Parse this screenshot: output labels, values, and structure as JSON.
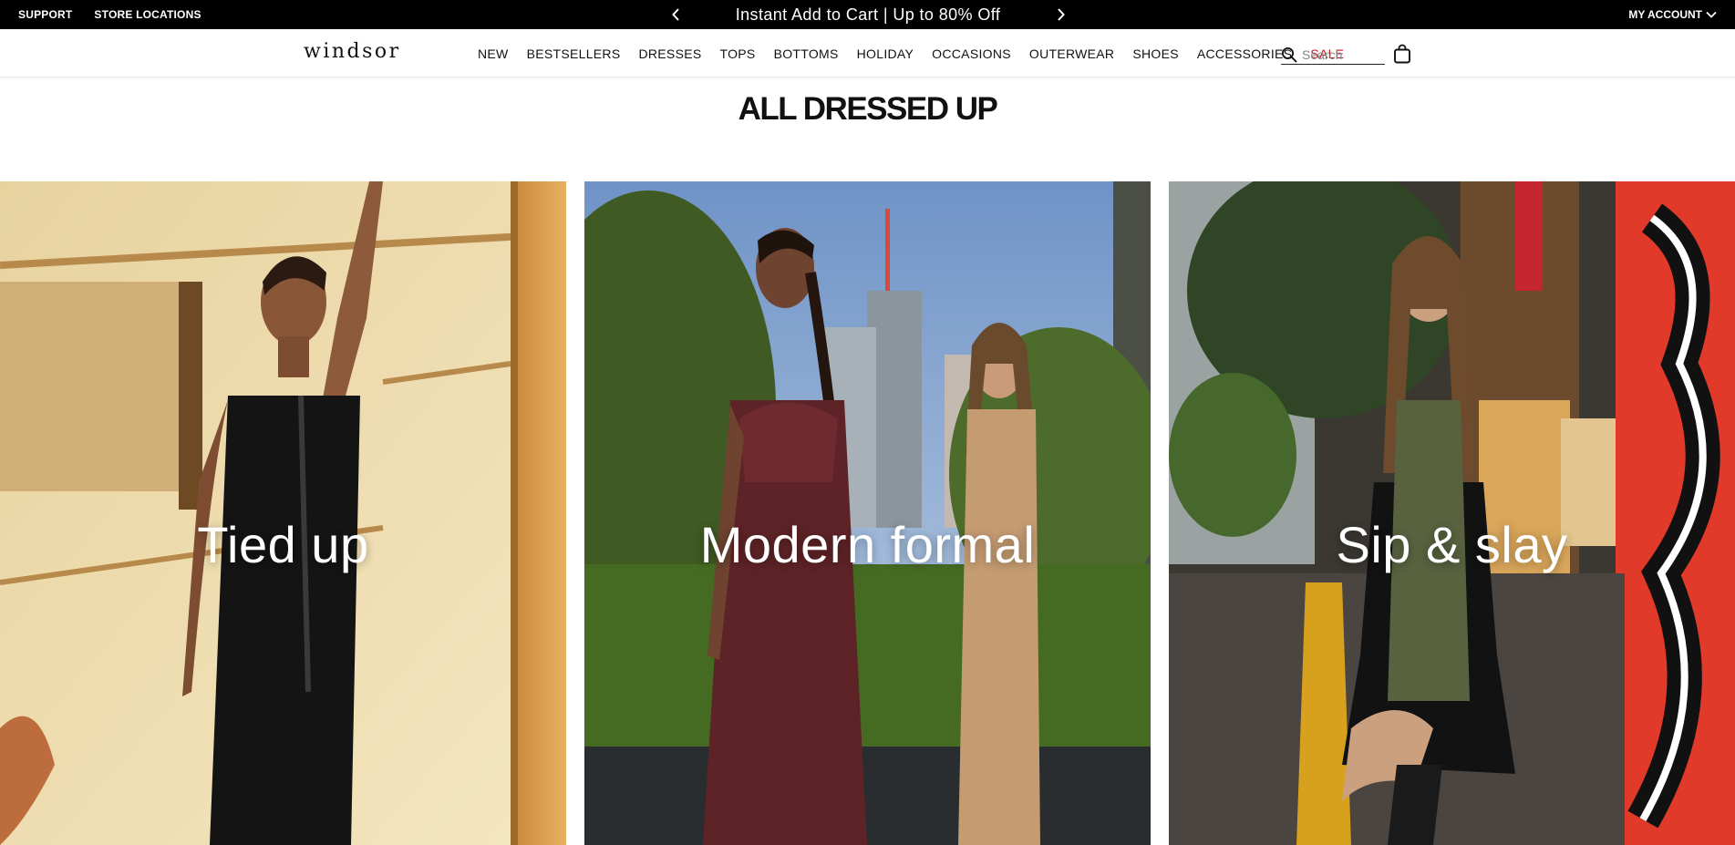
{
  "promo_bar": {
    "left_links": [
      {
        "label": "SUPPORT"
      },
      {
        "label": "STORE LOCATIONS"
      }
    ],
    "message": "Instant Add to Cart | Up to 80% Off",
    "prev_icon": "chevron-left-icon",
    "next_icon": "chevron-right-icon",
    "account_label": "MY ACCOUNT",
    "account_icon": "chevron-down-icon"
  },
  "header": {
    "logo": "windsor",
    "nav": [
      {
        "label": "NEW"
      },
      {
        "label": "BESTSELLERS"
      },
      {
        "label": "DRESSES"
      },
      {
        "label": "TOPS"
      },
      {
        "label": "BOTTOMS"
      },
      {
        "label": "HOLIDAY"
      },
      {
        "label": "OCCASIONS"
      },
      {
        "label": "OUTERWEAR"
      },
      {
        "label": "SHOES"
      },
      {
        "label": "ACCESSORIES"
      },
      {
        "label": "SALE"
      }
    ],
    "search": {
      "placeholder": "Search",
      "value": "",
      "icon": "search-icon"
    },
    "bag_icon": "shopping-bag-icon",
    "colors": {
      "sale": "#c1121f",
      "promo_bg": "#000000"
    }
  },
  "section": {
    "title": "ALL DRESSED UP",
    "cards": [
      {
        "title": "Tied up"
      },
      {
        "title": "Modern formal"
      },
      {
        "title": "Sip & slay"
      }
    ]
  }
}
